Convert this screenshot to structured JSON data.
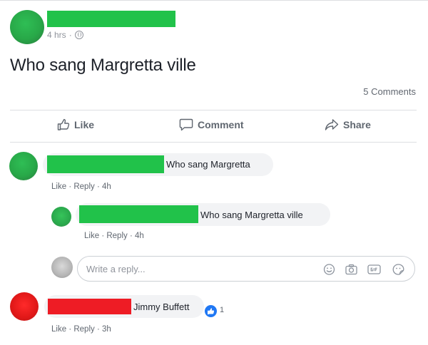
{
  "post": {
    "time": "4 hrs",
    "separator": "·",
    "text": "Who sang Margretta ville",
    "comments_count": "5 Comments"
  },
  "actions": {
    "like": "Like",
    "comment": "Comment",
    "share": "Share"
  },
  "comments": [
    {
      "text": "Who sang Margretta",
      "links": {
        "like": "Like",
        "reply": "Reply",
        "time": "4h"
      }
    }
  ],
  "replies": [
    {
      "text": "Who sang Margretta ville",
      "links": {
        "like": "Like",
        "reply": "Reply",
        "time": "4h"
      }
    }
  ],
  "reply_box": {
    "placeholder": "Write a reply..."
  },
  "second_comment": {
    "text": "Jimmy Buffett",
    "reaction_count": "1",
    "links": {
      "like": "Like",
      "reply": "Reply",
      "time": "3h"
    }
  },
  "icons": [
    "globe-icon",
    "like-thumb-icon",
    "comment-icon",
    "share-icon",
    "emoji-icon",
    "camera-icon",
    "gif-icon",
    "sticker-icon"
  ],
  "colors": {
    "redaction_green": "#21c24a",
    "redaction_red": "#ee1c25",
    "like_blue": "#2078f4"
  }
}
